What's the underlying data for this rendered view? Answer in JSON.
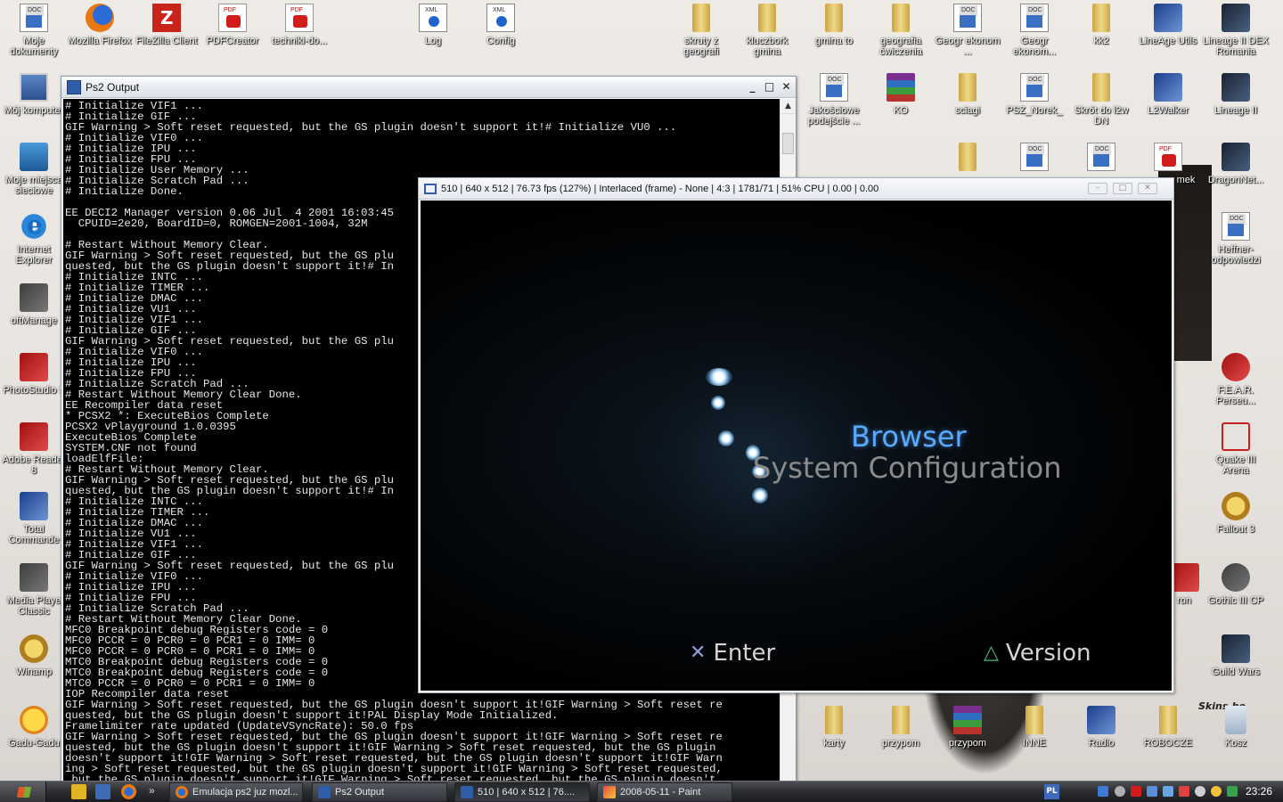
{
  "desktop": {
    "icons": [
      {
        "label": "Moje dokumenty",
        "icon": "my-documents-icon"
      },
      {
        "label": "Mozilla Firefox",
        "icon": "firefox-icon"
      },
      {
        "label": "FileZilla Client",
        "icon": "filezilla-icon"
      },
      {
        "label": "PDFCreator",
        "icon": "pdfcreator-icon"
      },
      {
        "label": "techniki-do...",
        "icon": "pdf-file-icon"
      },
      {
        "label": "Log",
        "icon": "xml-file-icon"
      },
      {
        "label": "Config",
        "icon": "xml-file-icon"
      },
      {
        "label": "skruty z geografi",
        "icon": "folder-icon"
      },
      {
        "label": "kluczbork gmina",
        "icon": "folder-icon"
      },
      {
        "label": "gmina to",
        "icon": "folder-icon"
      },
      {
        "label": "geografia ćwiczenia",
        "icon": "folder-icon"
      },
      {
        "label": "Geogr ekonom ...",
        "icon": "word-doc-icon"
      },
      {
        "label": "Geogr ekonom...",
        "icon": "word-doc-icon"
      },
      {
        "label": "kk2",
        "icon": "folder-icon"
      },
      {
        "label": "LineAge Utils",
        "icon": "lineage-utils-icon"
      },
      {
        "label": "Lineage II DEX Romania",
        "icon": "lineage-icon"
      },
      {
        "label": "Mój komputer",
        "icon": "my-computer-icon"
      },
      {
        "label": "Jakościowe podejście ...",
        "icon": "word-doc-icon"
      },
      {
        "label": "KO",
        "icon": "winrar-icon"
      },
      {
        "label": "sciagi",
        "icon": "folder-icon"
      },
      {
        "label": "PSZ_Norek_",
        "icon": "word-doc-icon"
      },
      {
        "label": "Skrót do l2w DN",
        "icon": "shortcut-icon"
      },
      {
        "label": "L2Walker",
        "icon": "l2walker-icon"
      },
      {
        "label": "Lineage II",
        "icon": "lineage-icon"
      },
      {
        "label": "Moje miejsca sieciowe",
        "icon": "network-places-icon"
      },
      {
        "label": "mek",
        "icon": "pdf-file-icon"
      },
      {
        "label": "DragonNet...",
        "icon": "lineage-icon"
      },
      {
        "label": "Internet Explorer",
        "icon": "internet-explorer-icon"
      },
      {
        "label": "Heffner-odpowiedzi",
        "icon": "word-doc-icon"
      },
      {
        "label": "oftManage",
        "icon": "app-icon"
      },
      {
        "label": "PhotoStudio 5",
        "icon": "photostudio-icon"
      },
      {
        "label": "F.E.A.R. Perseu...",
        "icon": "fear-icon"
      },
      {
        "label": "Adobe Reader 8",
        "icon": "adobe-reader-icon"
      },
      {
        "label": "Quake III Arena",
        "icon": "quake-icon"
      },
      {
        "label": "Total Commande",
        "icon": "total-commander-icon"
      },
      {
        "label": "Fallout 3",
        "icon": "fallout-icon"
      },
      {
        "label": "Media Playe Classic",
        "icon": "media-player-icon"
      },
      {
        "label": "Gothic III CP",
        "icon": "gothic-icon"
      },
      {
        "label": "ron",
        "icon": "app-icon"
      },
      {
        "label": "Winamp",
        "icon": "winamp-icon"
      },
      {
        "label": "Guild Wars",
        "icon": "guild-wars-icon"
      },
      {
        "label": "Gadu-Gadu",
        "icon": "gadu-gadu-icon"
      },
      {
        "label": "karty",
        "icon": "folder-icon"
      },
      {
        "label": "przypom",
        "icon": "folder-icon"
      },
      {
        "label": "przypom",
        "icon": "winrar-icon"
      },
      {
        "label": "INNE",
        "icon": "folder-icon"
      },
      {
        "label": "Radio",
        "icon": "radio-shortcut-icon"
      },
      {
        "label": "ROBOCZE",
        "icon": "folder-icon"
      },
      {
        "label": "Kosz",
        "icon": "recycle-bin-icon"
      }
    ],
    "wallpaper_mark": "Skins.be"
  },
  "console_window": {
    "title": "Ps2 Output",
    "lines": [
      "# Initialize VIF1 ...",
      "# Initialize GIF ...",
      "GIF Warning > Soft reset requested, but the GS plugin doesn't support it!# Initialize VU0 ...",
      "# Initialize VIF0 ...",
      "# Initialize IPU ...",
      "# Initialize FPU ...",
      "# Initialize User Memory ...",
      "# Initialize Scratch Pad ...",
      "# Initialize Done.",
      "",
      "EE DECI2 Manager version 0.06 Jul  4 2001 16:03:45",
      "  CPUID=2e20, BoardID=0, ROMGEN=2001-1004, 32M",
      "",
      "# Restart Without Memory Clear.",
      "GIF Warning > Soft reset requested, but the GS plu",
      "quested, but the GS plugin doesn't support it!# In",
      "# Initialize INTC ...",
      "# Initialize TIMER ...",
      "# Initialize DMAC ...",
      "# Initialize VU1 ...",
      "# Initialize VIF1 ...",
      "# Initialize GIF ...",
      "GIF Warning > Soft reset requested, but the GS plu",
      "# Initialize VIF0 ...",
      "# Initialize IPU ...",
      "# Initialize FPU ...",
      "# Initialize Scratch Pad ...",
      "# Restart Without Memory Clear Done.",
      "EE Recompiler data reset",
      "* PCSX2 *: ExecuteBios Complete",
      "PCSX2 vPlayground 1.0.0395",
      "ExecuteBios Complete",
      "SYSTEM.CNF not found",
      "loadElfFile:",
      "# Restart Without Memory Clear.",
      "GIF Warning > Soft reset requested, but the GS plu",
      "quested, but the GS plugin doesn't support it!# In",
      "# Initialize INTC ...",
      "# Initialize TIMER ...",
      "# Initialize DMAC ...",
      "# Initialize VU1 ...",
      "# Initialize VIF1 ...",
      "# Initialize GIF ...",
      "GIF Warning > Soft reset requested, but the GS plu",
      "# Initialize VIF0 ...",
      "# Initialize IPU ...",
      "# Initialize FPU ...",
      "# Initialize Scratch Pad ...",
      "# Restart Without Memory Clear Done.",
      "MFC0 Breakpoint debug Registers code = 0",
      "MFC0 PCCR = 0 PCR0 = 0 PCR1 = 0 IMM= 0",
      "MFC0 PCCR = 0 PCR0 = 0 PCR1 = 0 IMM= 0",
      "MTC0 Breakpoint debug Registers code = 0",
      "MTC0 Breakpoint debug Registers code = 0",
      "MTC0 PCCR = 0 PCR0 = 0 PCR1 = 0 IMM= 0",
      "IOP Recompiler data reset",
      "GIF Warning > Soft reset requested, but the GS plugin doesn't support it!GIF Warning > Soft reset re",
      "quested, but the GS plugin doesn't support it!PAL Display Mode Initialized.",
      "Framelimiter rate updated (UpdateVSyncRate): 50.0 fps",
      "GIF Warning > Soft reset requested, but the GS plugin doesn't support it!GIF Warning > Soft reset re",
      "quested, but the GS plugin doesn't support it!GIF Warning > Soft reset requested, but the GS plugin",
      "doesn't support it!GIF Warning > Soft reset requested, but the GS plugin doesn't support it!GIF Warn",
      "ing > Soft reset requested, but the GS plugin doesn't support it!GIF Warning > Soft reset requested,",
      " but the GS plugin doesn't support it!GIF Warning > Soft reset requested, but the GS plugin doesn't"
    ],
    "controls": {
      "minimize": "_",
      "maximize": "□",
      "close": "✕"
    }
  },
  "gs_window": {
    "title": "510 | 640 x 512 | 76.73 fps (127%) | Interlaced (frame) - None | 4:3 | 1781/71 | 51% CPU | 0.00 | 0.00",
    "controls": {
      "minimize": "–",
      "maximize": "□",
      "close": "✕"
    },
    "menu": {
      "selected": "Browser",
      "other": "System Configuration",
      "accent_color": "#5aa9ff"
    },
    "buttons": [
      {
        "symbol": "✕",
        "label": "Enter"
      },
      {
        "symbol": "△",
        "label": "Version"
      }
    ]
  },
  "taskbar": {
    "tasks": [
      {
        "label": "Emulacja ps2 juz mozl...",
        "icon": "firefox-icon"
      },
      {
        "label": "Ps2 Output",
        "icon": "pcsx2-icon"
      },
      {
        "label": "510 | 640 x 512 | 76....",
        "icon": "pcsx2-icon"
      },
      {
        "label": "2008-05-11 - Paint",
        "icon": "paint-icon"
      }
    ],
    "quick_launch_overflow": "»",
    "language": "PL",
    "clock": "23:26"
  }
}
